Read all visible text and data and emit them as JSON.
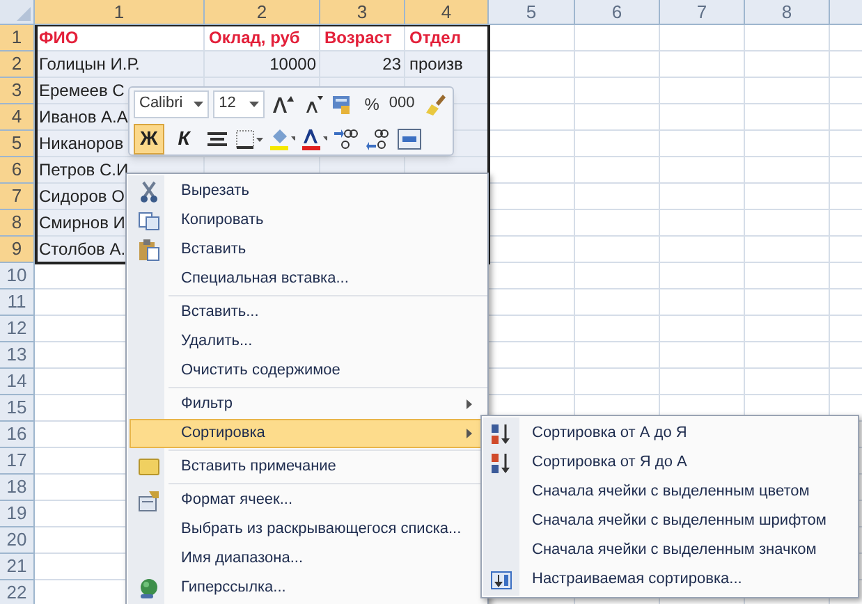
{
  "sheet": {
    "columns": [
      {
        "label": "1",
        "selected": true
      },
      {
        "label": "2",
        "selected": true
      },
      {
        "label": "3",
        "selected": true
      },
      {
        "label": "4",
        "selected": true
      },
      {
        "label": "5",
        "selected": false
      },
      {
        "label": "6",
        "selected": false
      },
      {
        "label": "7",
        "selected": false
      },
      {
        "label": "8",
        "selected": false
      }
    ],
    "rows": [
      {
        "label": "1",
        "selected": true,
        "cells": [
          {
            "kind": "header",
            "text": "ФИО"
          },
          {
            "kind": "header",
            "text": "Оклад, руб"
          },
          {
            "kind": "header",
            "text": "Возраст"
          },
          {
            "kind": "header",
            "text": "Отдел"
          }
        ]
      },
      {
        "label": "2",
        "selected": true,
        "cells": [
          {
            "kind": "text",
            "text": "Голицын И.Р."
          },
          {
            "kind": "number",
            "text": "10000"
          },
          {
            "kind": "number",
            "text": "23"
          },
          {
            "kind": "text",
            "text": "произв"
          }
        ]
      },
      {
        "label": "3",
        "selected": true,
        "cells": [
          {
            "kind": "text",
            "text": "Еремеев С"
          }
        ]
      },
      {
        "label": "4",
        "selected": true,
        "cells": [
          {
            "kind": "text",
            "text": "Иванов А.А"
          }
        ]
      },
      {
        "label": "5",
        "selected": true,
        "cells": [
          {
            "kind": "text",
            "text": "Никаноров"
          }
        ]
      },
      {
        "label": "6",
        "selected": true,
        "cells": [
          {
            "kind": "text",
            "text": "Петров С.И"
          }
        ]
      },
      {
        "label": "7",
        "selected": true,
        "cells": [
          {
            "kind": "text",
            "text": "Сидоров О"
          }
        ]
      },
      {
        "label": "8",
        "selected": true,
        "cells": [
          {
            "kind": "text",
            "text": "Смирнов И"
          }
        ]
      },
      {
        "label": "9",
        "selected": true,
        "cells": [
          {
            "kind": "text",
            "text": "Столбов А."
          }
        ]
      },
      {
        "label": "10",
        "selected": false
      },
      {
        "label": "11",
        "selected": false
      },
      {
        "label": "12",
        "selected": false
      },
      {
        "label": "13",
        "selected": false
      },
      {
        "label": "14",
        "selected": false
      },
      {
        "label": "15",
        "selected": false
      },
      {
        "label": "16",
        "selected": false
      },
      {
        "label": "17",
        "selected": false
      },
      {
        "label": "18",
        "selected": false
      },
      {
        "label": "19",
        "selected": false
      },
      {
        "label": "20",
        "selected": false
      },
      {
        "label": "21",
        "selected": false
      },
      {
        "label": "22",
        "selected": false
      }
    ]
  },
  "mini_toolbar": {
    "font": "Calibri",
    "size": "12",
    "percent": "%",
    "thousands": "000",
    "bold": {
      "label": "Ж",
      "selected": true
    },
    "italic": {
      "label": "К",
      "selected": false
    }
  },
  "context_menu": {
    "groups": [
      [
        {
          "label": "Вырезать",
          "submenu": false,
          "selected": false
        },
        {
          "label": "Копировать",
          "submenu": false,
          "selected": false
        },
        {
          "label": "Вставить",
          "submenu": false,
          "selected": false
        },
        {
          "label": "Специальная вставка...",
          "submenu": false,
          "selected": false
        }
      ],
      [
        {
          "label": "Вставить...",
          "submenu": false,
          "selected": false
        },
        {
          "label": "Удалить...",
          "submenu": false,
          "selected": false
        },
        {
          "label": "Очистить содержимое",
          "submenu": false,
          "selected": false
        }
      ],
      [
        {
          "label": "Фильтр",
          "submenu": true,
          "selected": false
        },
        {
          "label": "Сортировка",
          "submenu": true,
          "selected": true
        }
      ],
      [
        {
          "label": "Вставить примечание",
          "submenu": false,
          "selected": false
        }
      ],
      [
        {
          "label": "Формат ячеек...",
          "submenu": false,
          "selected": false
        },
        {
          "label": "Выбрать из раскрывающегося списка...",
          "submenu": false,
          "selected": false
        },
        {
          "label": "Имя диапазона...",
          "submenu": false,
          "selected": false
        },
        {
          "label": "Гиперссылка...",
          "submenu": false,
          "selected": false
        }
      ]
    ]
  },
  "submenu": {
    "items": [
      {
        "label": "Сортировка от А до Я"
      },
      {
        "label": "Сортировка от Я до А"
      },
      {
        "label": "Сначала ячейки с выделенным цветом"
      },
      {
        "label": "Сначала ячейки с выделенным шрифтом"
      },
      {
        "label": "Сначала ячейки с выделенным значком"
      },
      {
        "label": "Настраиваемая сортировка..."
      }
    ]
  }
}
